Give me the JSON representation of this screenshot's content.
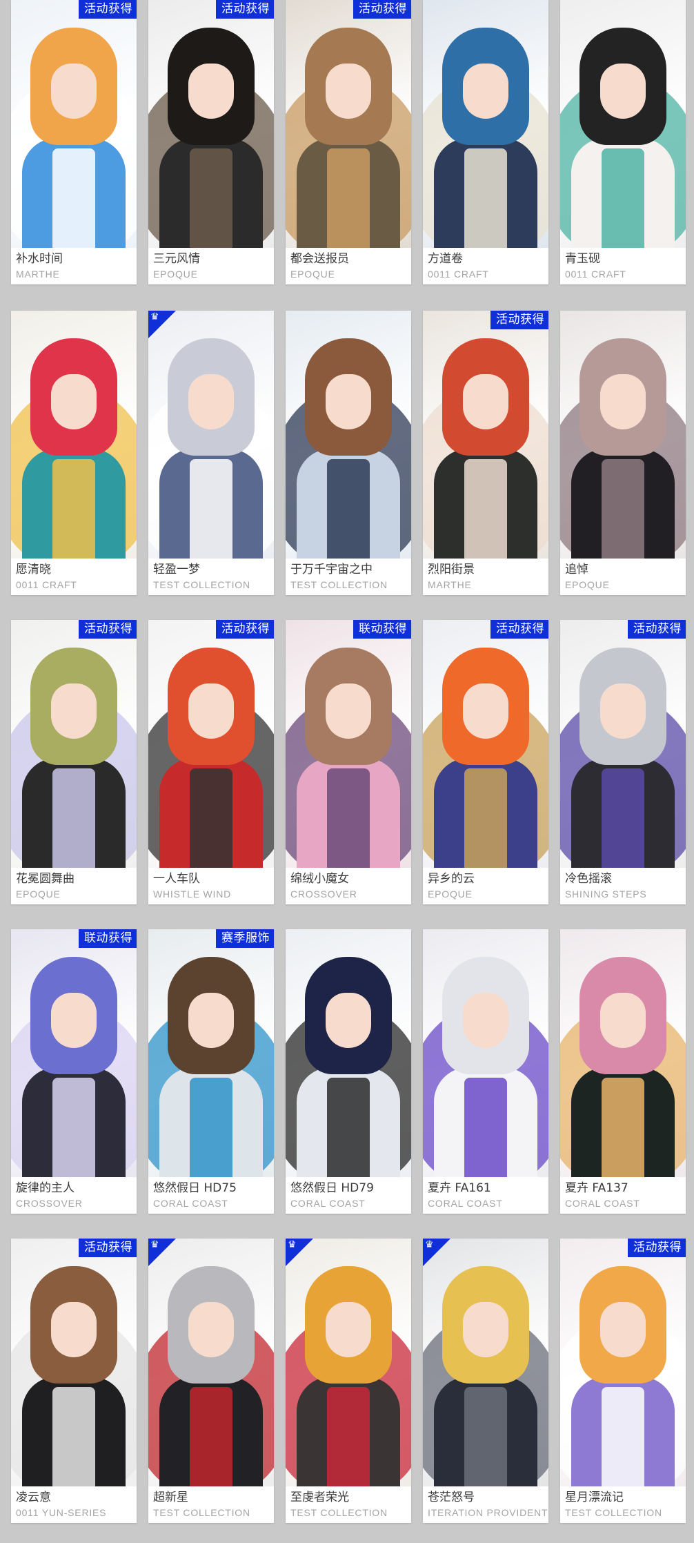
{
  "cards": [
    {
      "name": "补水时间",
      "brand": "MARTHE",
      "badge": "活动获得",
      "corner": false,
      "colors": {
        "bg": "#eef3f8",
        "hair": "#f0a54b",
        "body": "#4d9be0",
        "accent": "#ffffff"
      }
    },
    {
      "name": "三元风情",
      "brand": "EPOQUE",
      "badge": "活动获得",
      "corner": false,
      "colors": {
        "bg": "#ececec",
        "hair": "#1e1a18",
        "body": "#2b2b2b",
        "accent": "#6b5a4a"
      }
    },
    {
      "name": "都会送报员",
      "brand": "EPOQUE",
      "badge": "活动获得",
      "corner": false,
      "colors": {
        "bg": "#e2dbd2",
        "hair": "#a57a52",
        "body": "#6a5b45",
        "accent": "#c89b62"
      }
    },
    {
      "name": "方道卷",
      "brand": "0011 CRAFT",
      "badge": "",
      "corner": false,
      "colors": {
        "bg": "#dfe6ee",
        "hair": "#2e6fa8",
        "body": "#2d3c5a",
        "accent": "#e8e2d2"
      }
    },
    {
      "name": "青玉砚",
      "brand": "0011 CRAFT",
      "badge": "",
      "corner": false,
      "colors": {
        "bg": "#efeeee",
        "hair": "#232323",
        "body": "#f4f1ee",
        "accent": "#4fb3a4"
      }
    },
    {
      "name": "愿清晓",
      "brand": "0011 CRAFT",
      "badge": "",
      "corner": false,
      "colors": {
        "bg": "#f1efe8",
        "hair": "#e0344a",
        "body": "#2f9ba0",
        "accent": "#f0c04b"
      }
    },
    {
      "name": "轻盈一梦",
      "brand": "TEST COLLECTION",
      "badge": "",
      "corner": true,
      "colors": {
        "bg": "#eceef3",
        "hair": "#c9ccd6",
        "body": "#5a6990",
        "accent": "#ffffff"
      }
    },
    {
      "name": "于万千宇宙之中",
      "brand": "TEST COLLECTION",
      "badge": "",
      "corner": false,
      "colors": {
        "bg": "#e6ecf2",
        "hair": "#8b5a3c",
        "body": "#c7d3e2",
        "accent": "#2d3a55"
      }
    },
    {
      "name": "烈阳街景",
      "brand": "MARTHE",
      "badge": "活动获得",
      "corner": false,
      "colors": {
        "bg": "#eae5de",
        "hair": "#d24a2f",
        "body": "#2d2f2c",
        "accent": "#eddccf"
      }
    },
    {
      "name": "追悼",
      "brand": "EPOQUE",
      "badge": "",
      "corner": false,
      "colors": {
        "bg": "#e9e5e4",
        "hair": "#b69a98",
        "body": "#221f24",
        "accent": "#8d7a80"
      }
    },
    {
      "name": "花冕圆舞曲",
      "brand": "EPOQUE",
      "badge": "活动获得",
      "corner": false,
      "colors": {
        "bg": "#f0f0ee",
        "hair": "#a9ad62",
        "body": "#2a2a2a",
        "accent": "#c8c5e8"
      }
    },
    {
      "name": "一人车队",
      "brand": "WHISTLE WIND",
      "badge": "活动获得",
      "corner": false,
      "colors": {
        "bg": "#f3f3f3",
        "hair": "#e0502e",
        "body": "#c72a2a",
        "accent": "#333333"
      }
    },
    {
      "name": "绵绒小魔女",
      "brand": "CROSSOVER",
      "badge": "联动获得",
      "corner": false,
      "colors": {
        "bg": "#efe2e6",
        "hair": "#a77b62",
        "body": "#e7a6c3",
        "accent": "#6b4a7a"
      }
    },
    {
      "name": "异乡的云",
      "brand": "EPOQUE",
      "badge": "活动获得",
      "corner": false,
      "colors": {
        "bg": "#eceef2",
        "hair": "#ef6a2a",
        "body": "#3c3f8a",
        "accent": "#c8a25a"
      }
    },
    {
      "name": "冷色摇滚",
      "brand": "SHINING STEPS",
      "badge": "活动获得",
      "corner": false,
      "colors": {
        "bg": "#ededed",
        "hair": "#c4c7ce",
        "body": "#2c2c32",
        "accent": "#5a4aa8"
      }
    },
    {
      "name": "旋律的主人",
      "brand": "CROSSOVER",
      "badge": "联动获得",
      "corner": false,
      "colors": {
        "bg": "#e7e6f1",
        "hair": "#6a6fd0",
        "body": "#2d2c3a",
        "accent": "#d9d3f2"
      }
    },
    {
      "name": "悠然假日 HD75",
      "brand": "CORAL COAST",
      "badge": "赛季服饰",
      "corner": false,
      "colors": {
        "bg": "#e7ecef",
        "hair": "#5b4330",
        "body": "#dde4ea",
        "accent": "#2f93c8"
      }
    },
    {
      "name": "悠然假日 HD79",
      "brand": "CORAL COAST",
      "badge": "",
      "corner": false,
      "colors": {
        "bg": "#eceff3",
        "hair": "#1d2448",
        "body": "#e4e8ee",
        "accent": "#2a2a2a"
      }
    },
    {
      "name": "夏卉 FA161",
      "brand": "CORAL COAST",
      "badge": "",
      "corner": false,
      "colors": {
        "bg": "#ecebf0",
        "hair": "#e3e4ea",
        "body": "#f4f4f7",
        "accent": "#6a4ac8"
      }
    },
    {
      "name": "夏卉 FA137",
      "brand": "CORAL COAST",
      "badge": "",
      "corner": false,
      "colors": {
        "bg": "#efe9ec",
        "hair": "#d98aa8",
        "body": "#1c2522",
        "accent": "#e7b46a"
      }
    },
    {
      "name": "凌云意",
      "brand": "0011 YUN-SERIES",
      "badge": "活动获得",
      "corner": false,
      "colors": {
        "bg": "#efefef",
        "hair": "#8a5d3e",
        "body": "#1f1f22",
        "accent": "#e6e6e6"
      }
    },
    {
      "name": "超新星",
      "brand": "TEST COLLECTION",
      "badge": "",
      "corner": true,
      "colors": {
        "bg": "#ededed",
        "hair": "#b9b9bd",
        "body": "#222226",
        "accent": "#c0272d"
      }
    },
    {
      "name": "至虔者荣光",
      "brand": "TEST COLLECTION",
      "badge": "",
      "corner": true,
      "colors": {
        "bg": "#efece6",
        "hair": "#e7a335",
        "body": "#3a3434",
        "accent": "#c8283a"
      }
    },
    {
      "name": "苍茫怒号",
      "brand": "ITERATION PROVIDENT",
      "badge": "",
      "corner": true,
      "colors": {
        "bg": "#e3e4e6",
        "hair": "#e6c050",
        "body": "#2a2e3a",
        "accent": "#6a6e7a"
      }
    },
    {
      "name": "星月漂流记",
      "brand": "TEST COLLECTION",
      "badge": "活动获得",
      "corner": false,
      "colors": {
        "bg": "#f2ecee",
        "hair": "#f0a848",
        "body": "#8e7ad2",
        "accent": "#ffffff"
      }
    }
  ],
  "icons": {
    "corner_glyph": "♛"
  }
}
